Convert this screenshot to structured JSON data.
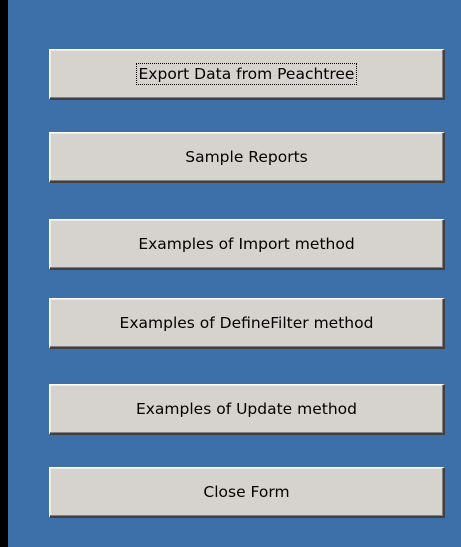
{
  "form": {
    "buttons": [
      {
        "label": "Export Data from Peachtree",
        "focused": true
      },
      {
        "label": "Sample Reports",
        "focused": false
      },
      {
        "label": "Examples of Import method",
        "focused": false
      },
      {
        "label": "Examples of DefineFilter method",
        "focused": false
      },
      {
        "label": "Examples of Update method",
        "focused": false
      },
      {
        "label": "Close Form",
        "focused": false
      }
    ]
  },
  "colors": {
    "form_background": "#3d6fa8",
    "button_face": "#d6d3ce",
    "outer_background": "#000000"
  }
}
